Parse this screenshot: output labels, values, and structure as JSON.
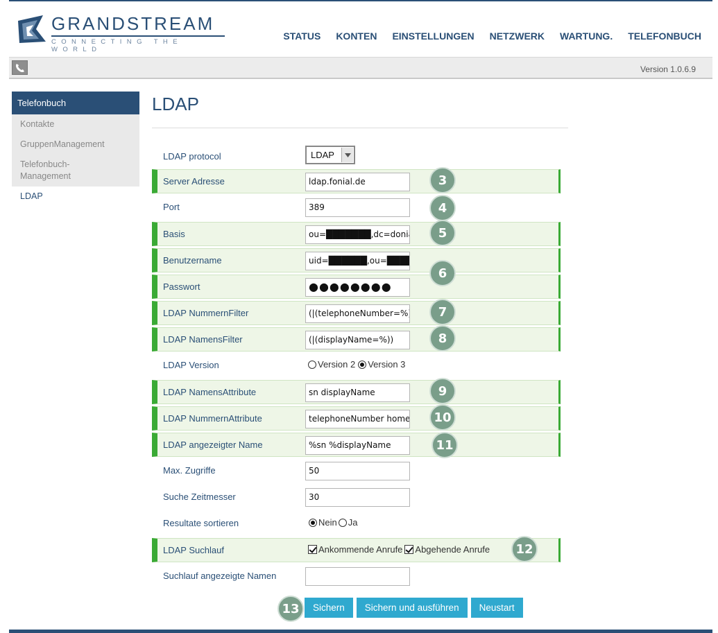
{
  "brand": {
    "name": "GRANDSTREAM",
    "tagline": "CONNECTING THE WORLD"
  },
  "nav": [
    "STATUS",
    "KONTEN",
    "EINSTELLUNGEN",
    "NETZWERK",
    "WARTUNG.",
    "TELEFONBUCH"
  ],
  "version": "Version 1.0.6.9",
  "sidebar": {
    "title": "Telefonbuch",
    "items": [
      "Kontakte",
      "GruppenManagement",
      "Telefonbuch-\nManagement",
      "LDAP"
    ]
  },
  "page_title": "LDAP",
  "form": {
    "protocol": {
      "label": "LDAP protocol",
      "value": "LDAP"
    },
    "server": {
      "label": "Server Adresse",
      "value": "ldap.fonial.de"
    },
    "port": {
      "label": "Port",
      "value": "389"
    },
    "basis": {
      "label": "Basis",
      "value": "ou=███████,dc=donial,d"
    },
    "user": {
      "label": "Benutzername",
      "value": "uid=██████,ou=█████"
    },
    "password": {
      "label": "Passwort",
      "value": "●●●●●●●●"
    },
    "num_filter": {
      "label": "LDAP NummernFilter",
      "value": "(|(telephoneNumber=%)"
    },
    "name_filter": {
      "label": "LDAP NamensFilter",
      "value": "(|(displayName=%))"
    },
    "version": {
      "label": "LDAP Version",
      "opt1": "Version 2",
      "opt2": "Version 3"
    },
    "name_attr": {
      "label": "LDAP NamensAttribute",
      "value": "sn displayName"
    },
    "num_attr": {
      "label": "LDAP NummernAttribute",
      "value": "telephoneNumber homeF"
    },
    "display_name": {
      "label": "LDAP angezeigter Name",
      "value": "%sn %displayName"
    },
    "max_hits": {
      "label": "Max. Zugriffe",
      "value": "50"
    },
    "timeout": {
      "label": "Suche Zeitmesser",
      "value": "30"
    },
    "sort": {
      "label": "Resultate sortieren",
      "opt1": "Nein",
      "opt2": "Ja"
    },
    "lookup": {
      "label": "LDAP Suchlauf",
      "opt1": "Ankommende Anrufe",
      "opt2": "Abgehende Anrufe"
    },
    "lookup_names": {
      "label": "Suchlauf angezeigte Namen",
      "value": ""
    }
  },
  "badges": [
    "3",
    "4",
    "5",
    "6",
    "7",
    "8",
    "9",
    "10",
    "11",
    "12",
    "13"
  ],
  "buttons": {
    "save": "Sichern",
    "save_apply": "Sichern und ausführen",
    "reboot": "Neustart"
  },
  "colors": {
    "brand": "#2a4f76",
    "highlight_border": "#3aaa35",
    "highlight_bg": "#eef6e7",
    "button": "#2fa9cf",
    "badge": "#7a9e8a"
  }
}
